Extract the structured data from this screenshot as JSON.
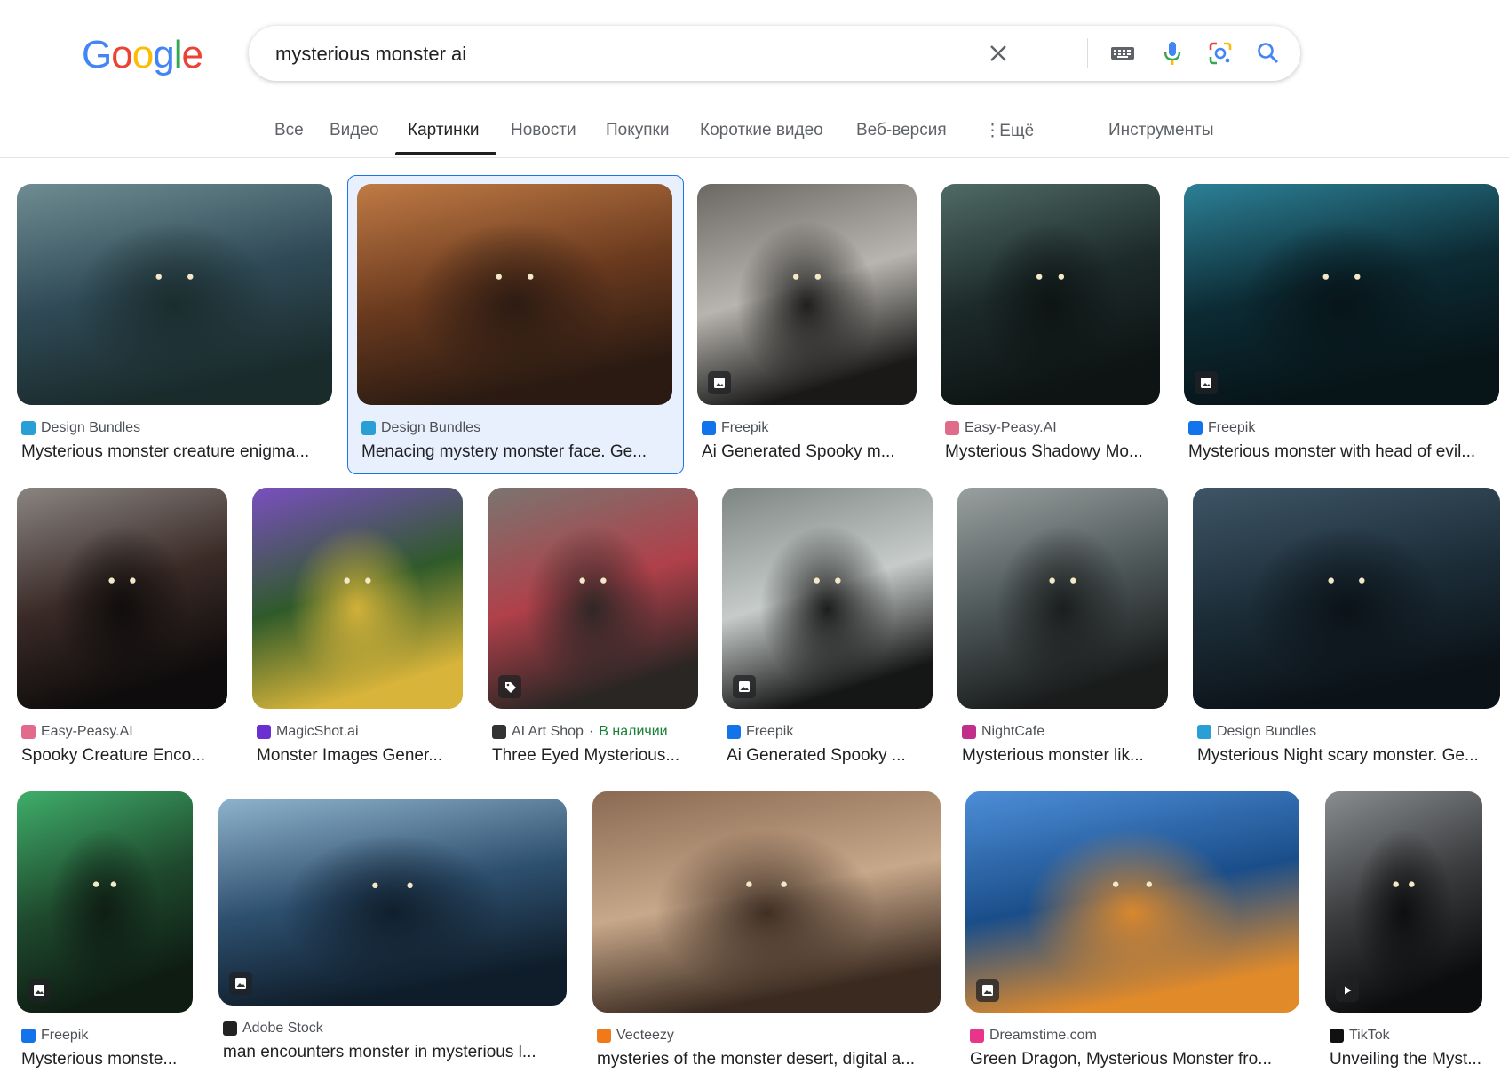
{
  "logo": {
    "letters": [
      "G",
      "o",
      "o",
      "g",
      "l",
      "e"
    ],
    "colors": [
      "#4285F4",
      "#EA4335",
      "#FBBC05",
      "#4285F4",
      "#34A853",
      "#EA4335"
    ]
  },
  "search": {
    "query": "mysterious monster ai"
  },
  "tabs": [
    {
      "label": "Все"
    },
    {
      "label": "Видео"
    },
    {
      "label": "Картинки"
    },
    {
      "label": "Новости"
    },
    {
      "label": "Покупки"
    },
    {
      "label": "Короткие видео"
    },
    {
      "label": "Веб-версия"
    },
    {
      "label": "Ещё"
    },
    {
      "label": "Инструменты"
    }
  ],
  "results": [
    {
      "source": "Design Bundles",
      "title": "Mysterious monster creature enigma...",
      "icon": "design-bundles",
      "fav_color": "#2a9fd6",
      "colors": [
        "#2f4a56",
        "#6f8c92",
        "#1a2b2c"
      ],
      "badge": "none"
    },
    {
      "source": "Design Bundles",
      "title": "Menacing mystery monster face. Ge...",
      "icon": "design-bundles",
      "fav_color": "#2a9fd6",
      "colors": [
        "#6a3a1e",
        "#c07a45",
        "#2a1a12"
      ],
      "badge": "none"
    },
    {
      "source": "Freepik",
      "title": "Ai Generated Spooky m...",
      "icon": "freepik",
      "fav_color": "#1273eb",
      "colors": [
        "#b8b5b0",
        "#6b6863",
        "#1a1918"
      ],
      "badge": "image"
    },
    {
      "source": "Easy-Peasy.AI",
      "title": "Mysterious Shadowy Mo...",
      "icon": "easy-peasy",
      "fav_color": "#e06b8b",
      "colors": [
        "#1d2a2a",
        "#4f6b66",
        "#0d1413"
      ],
      "badge": "none"
    },
    {
      "source": "Freepik",
      "title": "Mysterious monster with head of evil...",
      "icon": "freepik",
      "fav_color": "#1273eb",
      "colors": [
        "#0c2a33",
        "#2c8096",
        "#071418"
      ],
      "badge": "image"
    },
    {
      "source": "Easy-Peasy.AI",
      "title": "Spooky Creature Enco...",
      "icon": "easy-peasy",
      "fav_color": "#e06b8b",
      "colors": [
        "#3a2a26",
        "#8a8582",
        "#0e0c0c"
      ],
      "badge": "none"
    },
    {
      "source": "MagicShot.ai",
      "title": "Monster Images Gener...",
      "icon": "magicshot",
      "fav_color": "#6a2fd0",
      "colors": [
        "#2f5a2a",
        "#7a4fc0",
        "#d8b43a"
      ],
      "badge": "none"
    },
    {
      "source": "AI Art Shop",
      "stock": "В наличии",
      "title": "Three Eyed Mysterious...",
      "icon": "ai-art-shop",
      "fav_color": "#333333",
      "colors": [
        "#b0404a",
        "#7a7570",
        "#2a2624"
      ],
      "badge": "tag"
    },
    {
      "source": "Freepik",
      "title": "Ai Generated Spooky ...",
      "icon": "freepik",
      "fav_color": "#1273eb",
      "colors": [
        "#c7ccca",
        "#7d8582",
        "#151616"
      ],
      "badge": "image"
    },
    {
      "source": "NightCafe",
      "title": "Mysterious monster lik...",
      "icon": "nightcafe",
      "fav_color": "#c0308a",
      "colors": [
        "#4d5758",
        "#9aa0a0",
        "#1a1c1c"
      ],
      "badge": "none"
    },
    {
      "source": "Design Bundles",
      "title": "Mysterious Night scary monster. Ge...",
      "icon": "design-bundles",
      "fav_color": "#2a9fd6",
      "colors": [
        "#1c2d38",
        "#3e5566",
        "#0b1218"
      ],
      "badge": "none"
    },
    {
      "source": "Freepik",
      "title": "Mysterious monste...",
      "icon": "freepik",
      "fav_color": "#1273eb",
      "colors": [
        "#1f4a2e",
        "#3fae6a",
        "#0e1c12"
      ],
      "badge": "image"
    },
    {
      "source": "Adobe Stock",
      "title": "man encounters monster in mysterious l...",
      "icon": "adobe-stock",
      "fav_color": "#222222",
      "colors": [
        "#2d4f6e",
        "#8fb2cc",
        "#0f1d2a"
      ],
      "badge": "image"
    },
    {
      "source": "Vecteezy",
      "title": "mysteries of the monster desert, digital a...",
      "icon": "vecteezy",
      "fav_color": "#f07a1a",
      "colors": [
        "#c8a88a",
        "#8a6a52",
        "#3a2a20"
      ],
      "badge": "none"
    },
    {
      "source": "Dreamstime.com",
      "title": "Green Dragon, Mysterious Monster fro...",
      "icon": "dreamstime",
      "fav_color": "#e8358a",
      "colors": [
        "#1a4e8a",
        "#4d8ed8",
        "#e08a2a"
      ],
      "badge": "image"
    },
    {
      "source": "TikTok",
      "title": "Unveiling the Myst...",
      "icon": "tiktok",
      "fav_color": "#111111",
      "colors": [
        "#3a3c3e",
        "#8a8d90",
        "#0c0d0e"
      ],
      "badge": "video"
    }
  ]
}
